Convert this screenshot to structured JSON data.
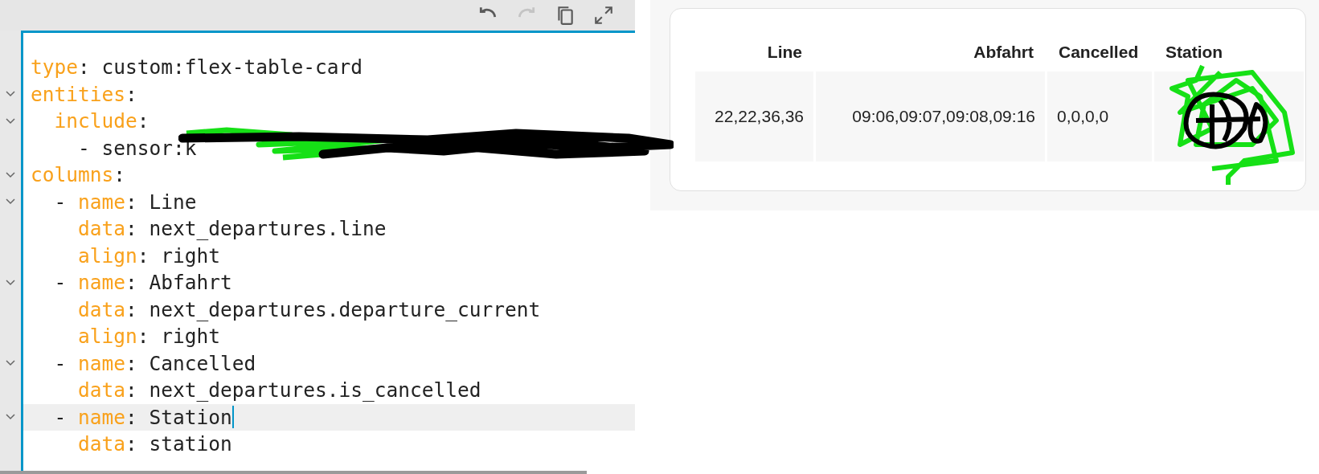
{
  "toolbar": {
    "buttons": [
      {
        "kind": "undo",
        "disabled": false
      },
      {
        "kind": "redo",
        "disabled": true
      },
      {
        "kind": "copy",
        "disabled": false
      },
      {
        "kind": "fullscreen",
        "disabled": false
      }
    ]
  },
  "editor": {
    "lines": [
      {
        "foldable": false,
        "active": false,
        "tokens": [
          {
            "kind": "key",
            "text": "type"
          },
          {
            "kind": "plain",
            "text": ": custom:flex-table-card"
          }
        ]
      },
      {
        "foldable": true,
        "active": false,
        "tokens": [
          {
            "kind": "key",
            "text": "entities"
          },
          {
            "kind": "plain",
            "text": ":"
          }
        ]
      },
      {
        "foldable": true,
        "active": false,
        "tokens": [
          {
            "kind": "key",
            "text": "  include"
          },
          {
            "kind": "plain",
            "text": ":"
          }
        ]
      },
      {
        "foldable": false,
        "active": false,
        "tokens": [
          {
            "kind": "plain",
            "text": "    - sensor:k"
          }
        ]
      },
      {
        "foldable": true,
        "active": false,
        "tokens": [
          {
            "kind": "key",
            "text": "columns"
          },
          {
            "kind": "plain",
            "text": ":"
          }
        ]
      },
      {
        "foldable": true,
        "active": false,
        "tokens": [
          {
            "kind": "plain",
            "text": "  - "
          },
          {
            "kind": "key",
            "text": "name"
          },
          {
            "kind": "plain",
            "text": ": Line"
          }
        ]
      },
      {
        "foldable": false,
        "active": false,
        "tokens": [
          {
            "kind": "key",
            "text": "    data"
          },
          {
            "kind": "plain",
            "text": ": next_departures.line"
          }
        ]
      },
      {
        "foldable": false,
        "active": false,
        "tokens": [
          {
            "kind": "key",
            "text": "    align"
          },
          {
            "kind": "plain",
            "text": ": right"
          }
        ]
      },
      {
        "foldable": true,
        "active": false,
        "tokens": [
          {
            "kind": "plain",
            "text": "  - "
          },
          {
            "kind": "key",
            "text": "name"
          },
          {
            "kind": "plain",
            "text": ": Abfahrt"
          }
        ]
      },
      {
        "foldable": false,
        "active": false,
        "tokens": [
          {
            "kind": "key",
            "text": "    data"
          },
          {
            "kind": "plain",
            "text": ": next_departures.departure_current"
          }
        ]
      },
      {
        "foldable": false,
        "active": false,
        "tokens": [
          {
            "kind": "key",
            "text": "    align"
          },
          {
            "kind": "plain",
            "text": ": right"
          }
        ]
      },
      {
        "foldable": true,
        "active": false,
        "tokens": [
          {
            "kind": "plain",
            "text": "  - "
          },
          {
            "kind": "key",
            "text": "name"
          },
          {
            "kind": "plain",
            "text": ": Cancelled"
          }
        ]
      },
      {
        "foldable": false,
        "active": false,
        "tokens": [
          {
            "kind": "key",
            "text": "    data"
          },
          {
            "kind": "plain",
            "text": ": next_departures.is_cancelled"
          }
        ]
      },
      {
        "foldable": true,
        "active": true,
        "tokens": [
          {
            "kind": "plain",
            "text": "  - "
          },
          {
            "kind": "key",
            "text": "name"
          },
          {
            "kind": "plain",
            "text": ": Station"
          }
        ]
      },
      {
        "foldable": false,
        "active": false,
        "tokens": [
          {
            "kind": "key",
            "text": "    data"
          },
          {
            "kind": "plain",
            "text": ": station"
          }
        ]
      }
    ]
  },
  "card": {
    "columns": [
      {
        "label": "Line",
        "right_aligned": true
      },
      {
        "label": "Abfahrt",
        "right_aligned": true
      },
      {
        "label": "Cancelled",
        "right_aligned": false
      },
      {
        "label": "Station",
        "right_aligned": false
      }
    ],
    "rows": [
      {
        "cells": [
          "22,22,36,36",
          "09:06,09:07,09:08,09:16",
          "0,0,0,0"
        ]
      }
    ]
  }
}
